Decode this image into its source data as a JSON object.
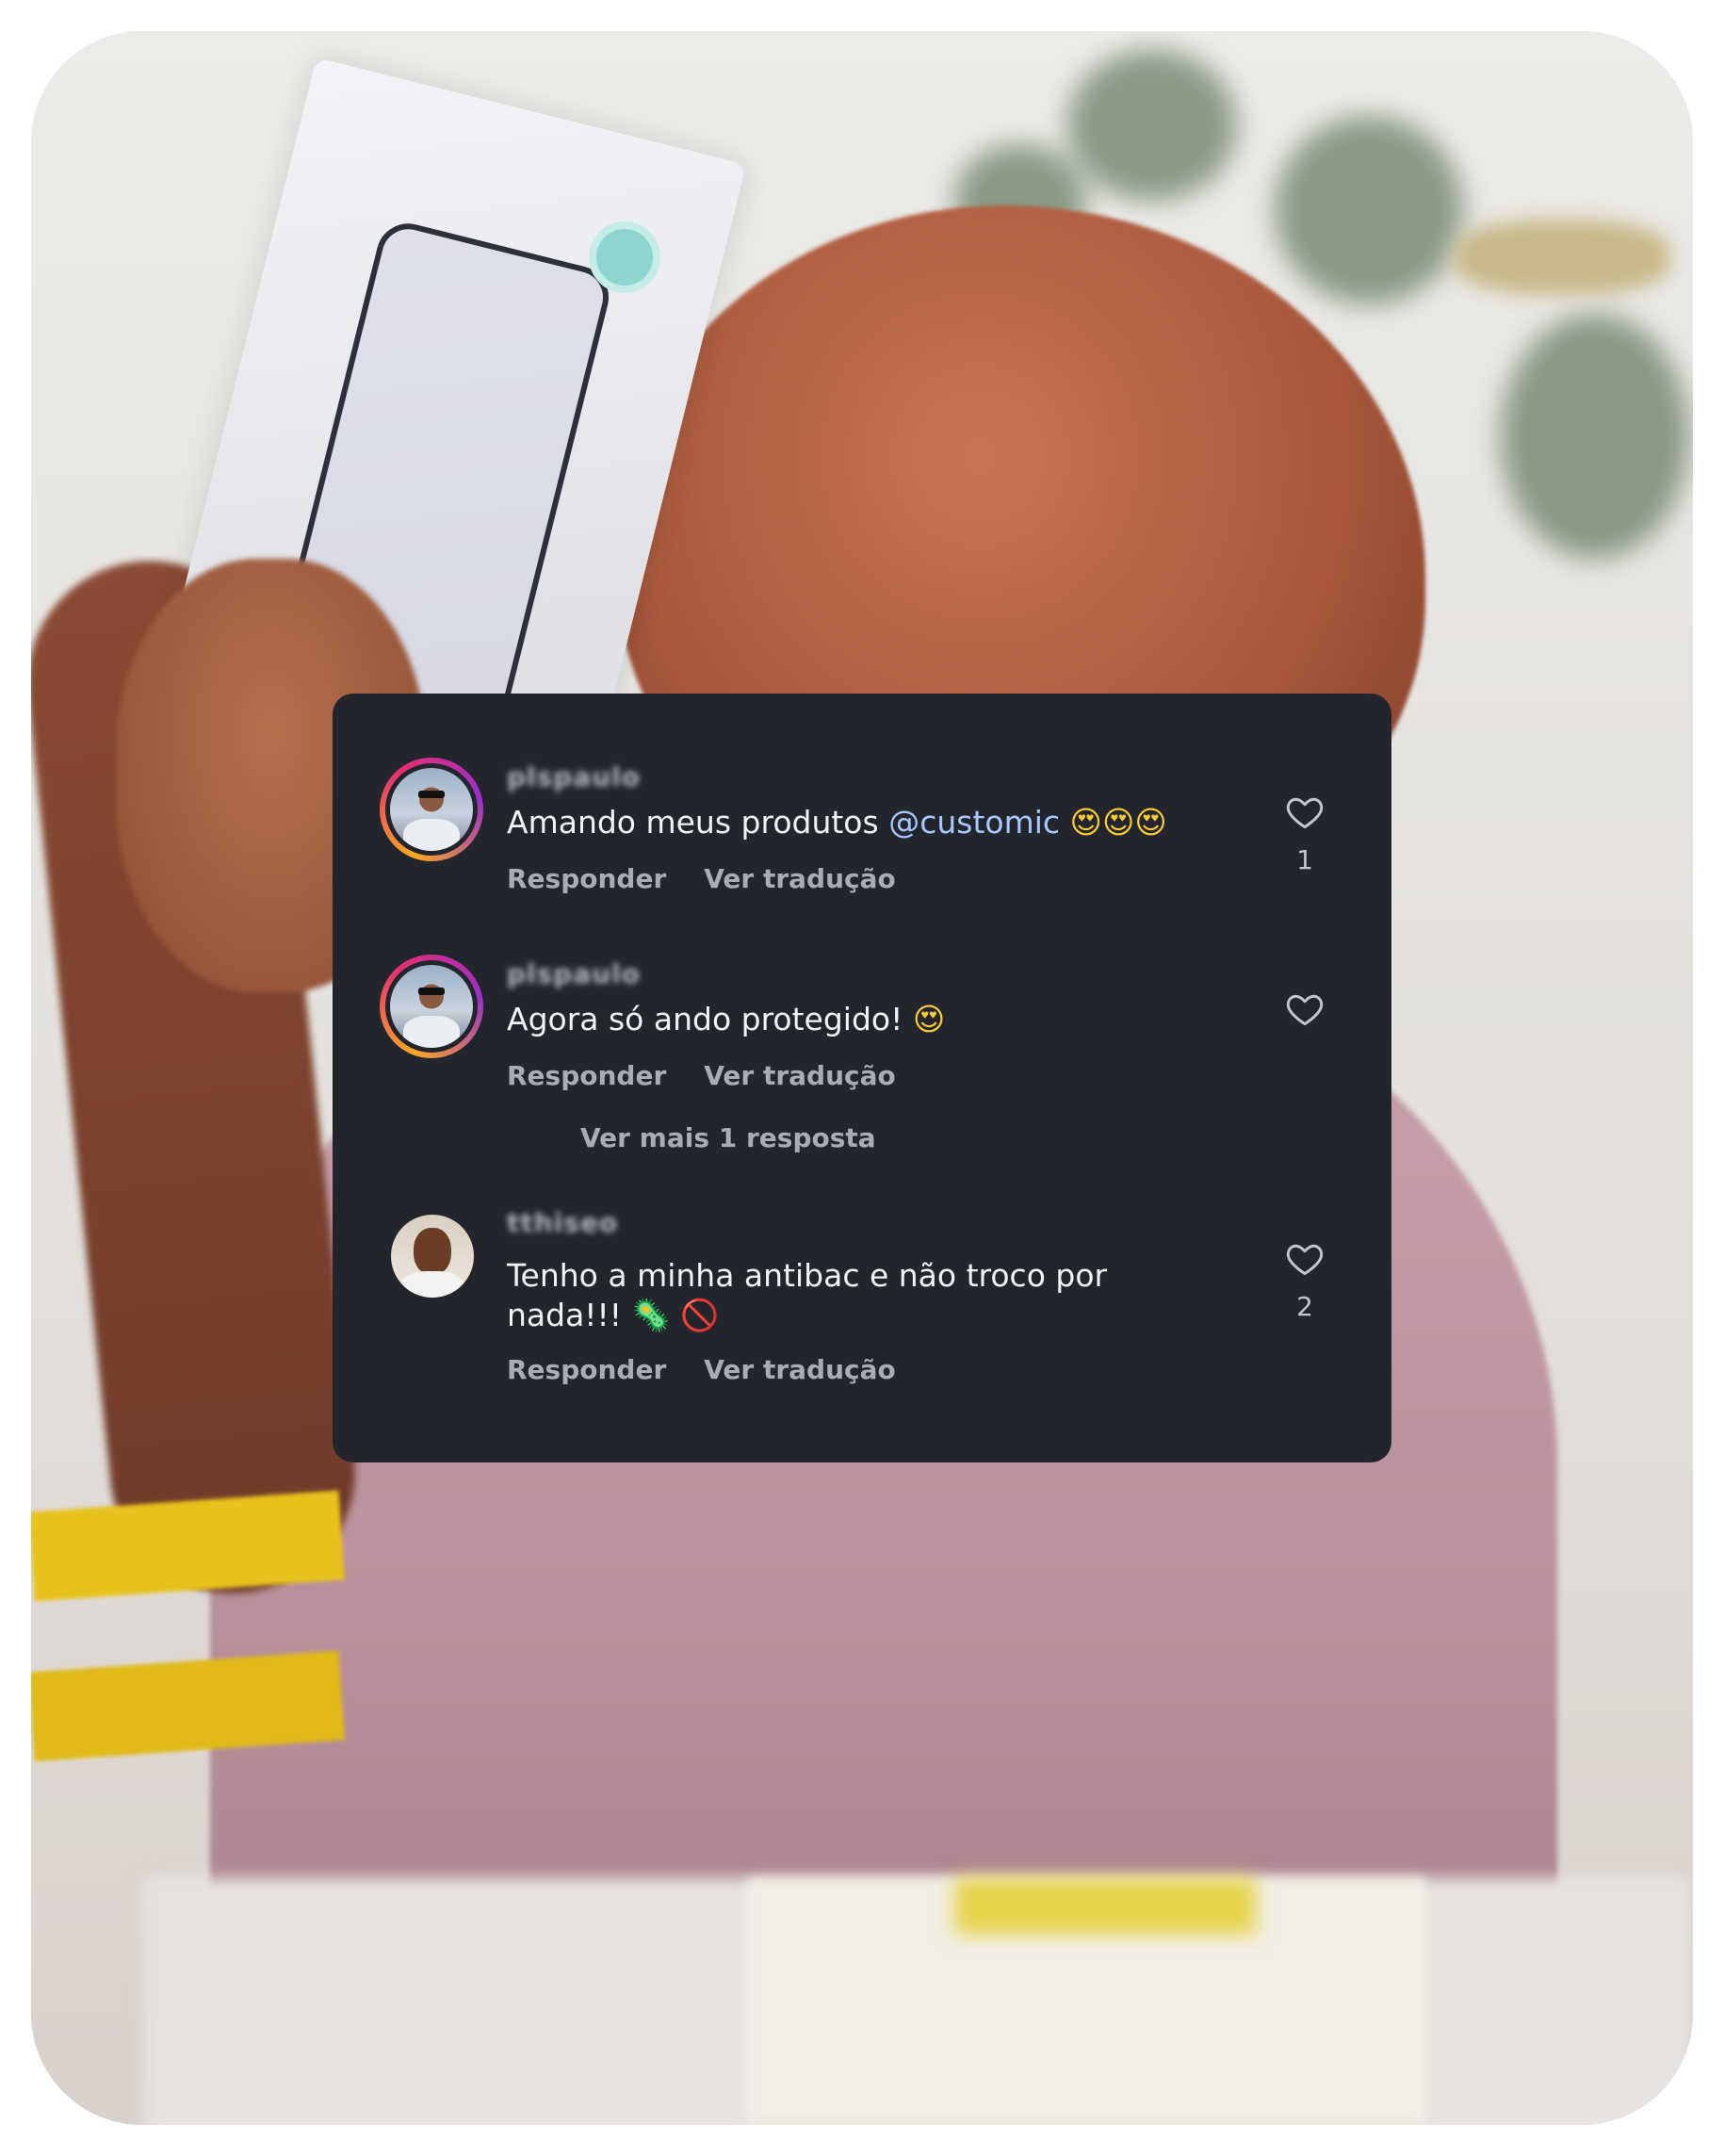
{
  "comments": [
    {
      "username": "plspaulo",
      "text": "Amando meus produtos",
      "mention": "@customic",
      "emoji": "😍😍😍",
      "reply_label": "Responder",
      "translate_label": "Ver tradução",
      "likes": "1",
      "avatar_style": "story-ring"
    },
    {
      "username": "plspaulo",
      "text": "Agora só ando protegido!",
      "emoji": "😍",
      "reply_label": "Responder",
      "translate_label": "Ver tradução",
      "likes": "",
      "avatar_style": "story-ring"
    },
    {
      "username": "tthiseo",
      "text": "Tenho a minha antibac e não troco por nada!!!",
      "emoji_germ": "🦠",
      "emoji_prohibited": "🚫",
      "reply_label": "Responder",
      "translate_label": "Ver tradução",
      "likes": "2",
      "avatar_style": "plain"
    }
  ],
  "view_more_replies": "Ver mais 1 resposta",
  "colors": {
    "panel_bg": "#22252c",
    "mention": "#a6c8ff",
    "primary_text": "#f2f3f5",
    "secondary_text": "#a9acb3"
  },
  "icons": {
    "like": "heart-outline-icon"
  }
}
